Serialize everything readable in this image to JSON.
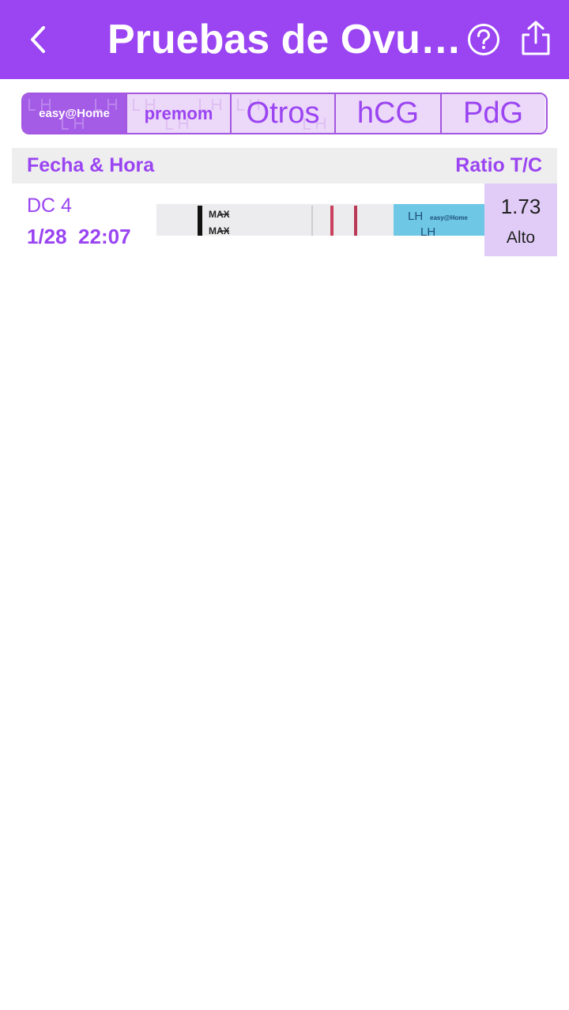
{
  "header": {
    "title": "Pruebas de Ovu…",
    "back_icon": "chevron-left-icon",
    "help_icon": "help-circle-icon",
    "share_icon": "share-icon",
    "background_color": "#9a44f2"
  },
  "tabs": [
    {
      "id": "easy-home",
      "label": "easy@Home",
      "selected": true
    },
    {
      "id": "premom",
      "label": "premom"
    },
    {
      "id": "otros",
      "label": "Otros"
    },
    {
      "id": "hcg",
      "label": "hCG"
    },
    {
      "id": "pdg",
      "label": "PdG"
    }
  ],
  "table": {
    "header": {
      "date_time": "Fecha & Hora",
      "ratio": "Ratio T/C"
    },
    "rows": [
      {
        "cycle_day": "DC 4",
        "date_time": "1/28  22:07",
        "ratio_value": "1.73",
        "ratio_level": "Alto",
        "strip": {
          "max_label": "MAX",
          "strip_label": "LH",
          "strip_brand": "easy@Home"
        }
      }
    ]
  },
  "colors": {
    "accent": "#9a44f2",
    "ratio_highlight": "#e1ccf8",
    "header_row": "#eeeeee"
  }
}
